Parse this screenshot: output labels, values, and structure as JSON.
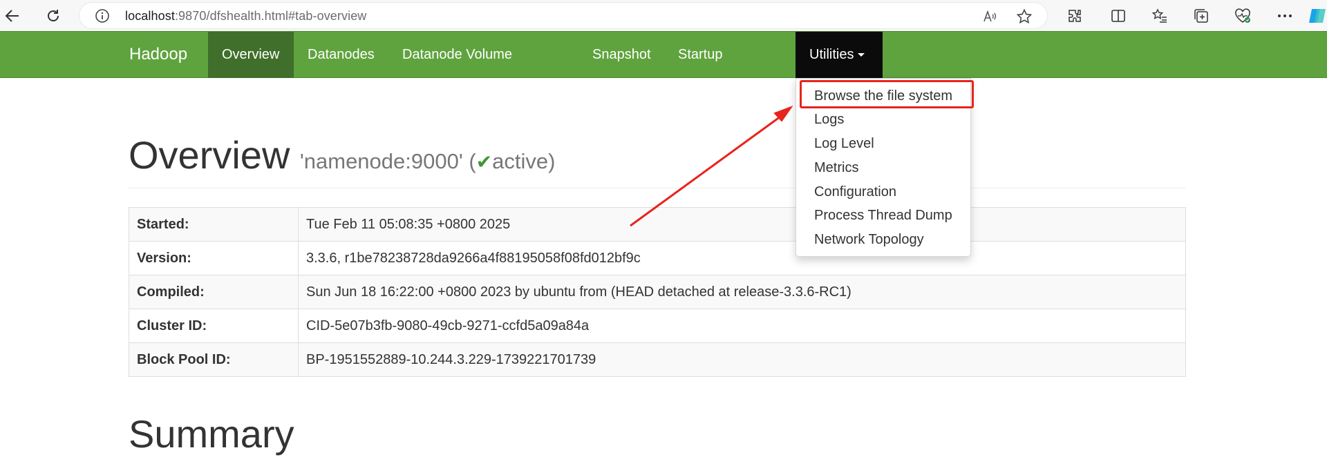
{
  "browser": {
    "url_host": "localhost",
    "url_rest": ":9870/dfshealth.html#tab-overview"
  },
  "navbar": {
    "brand": "Hadoop",
    "tabs": [
      {
        "label": "Overview"
      },
      {
        "label": "Datanodes"
      },
      {
        "label": "Datanode Volume Failures"
      },
      {
        "label": "Snapshot"
      },
      {
        "label": "Startup Progress"
      },
      {
        "label": "Utilities"
      }
    ]
  },
  "utilities_menu": {
    "items": [
      {
        "label": "Browse the file system"
      },
      {
        "label": "Logs"
      },
      {
        "label": "Log Level"
      },
      {
        "label": "Metrics"
      },
      {
        "label": "Configuration"
      },
      {
        "label": "Process Thread Dump"
      },
      {
        "label": "Network Topology"
      }
    ],
    "highlighted_item": "Browse the file system"
  },
  "overview": {
    "title": "Overview",
    "host": "'namenode:9000' (",
    "state": "active)",
    "rows": [
      {
        "key": "Started:",
        "value": "Tue Feb 11 05:08:35 +0800 2025"
      },
      {
        "key": "Version:",
        "value": "3.3.6, r1be78238728da9266a4f88195058f08fd012bf9c"
      },
      {
        "key": "Compiled:",
        "value": "Sun Jun 18 16:22:00 +0800 2023 by ubuntu from (HEAD detached at release-3.3.6-RC1)"
      },
      {
        "key": "Cluster ID:",
        "value": "CID-5e07b3fb-9080-49cb-9271-ccfd5a09a84a"
      },
      {
        "key": "Block Pool ID:",
        "value": "BP-1951552889-10.244.3.229-1739221701739"
      }
    ]
  },
  "summary": {
    "title": "Summary"
  },
  "colors": {
    "navbar_green": "#5fa33e",
    "active_tab": "#3f6f2a",
    "utilities_tab": "#0b0b0b",
    "annotation_red": "#e8231c",
    "check_green": "#3c9a2e"
  },
  "icons": {
    "back": "back-arrow-icon",
    "reload": "reload-icon",
    "site_info": "info-icon",
    "read_aloud": "read-aloud-icon",
    "favorite": "star-icon",
    "extensions": "puzzle-icon",
    "split_screen": "split-screen-icon",
    "favorites_list": "favorites-list-icon",
    "collections": "collections-icon",
    "browser_essentials": "heart-pulse-icon",
    "more": "more-dots-icon",
    "copilot": "copilot-icon"
  }
}
